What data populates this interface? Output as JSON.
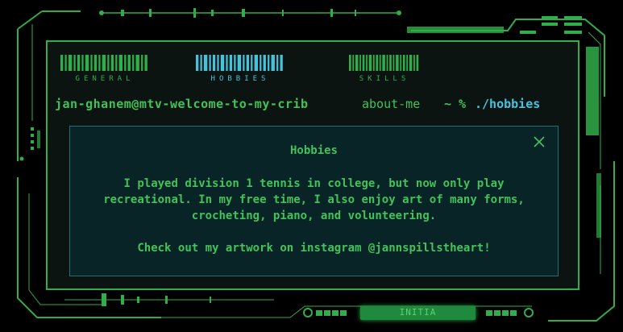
{
  "tabs": [
    {
      "label": "GENERAL",
      "color": "#2fae4a"
    },
    {
      "label": "HOBBIES",
      "color": "#48c1db",
      "active": true
    },
    {
      "label": "SKILLS",
      "color": "#2fae4a"
    }
  ],
  "prompt": {
    "user_host": "jan-ghanem@mtv-welcome-to-my-crib",
    "directory": "about-me",
    "symbol": "~ %",
    "command": "./hobbies"
  },
  "dialog": {
    "title": "Hobbies",
    "paragraph1": "I played division 1 tennis in college, but now only play recreational. In my free time, I also enjoy art of many forms, crocheting, piano, and volunteering.",
    "paragraph2": "Check out my artwork on instagram @jannspillstheart!",
    "close_icon": "close-icon"
  },
  "bottom_bar": {
    "label": "INITIA"
  },
  "colors": {
    "accent_green": "#2fae4a",
    "accent_cyan": "#48c1db",
    "dialog_bg": "#082427",
    "dialog_border": "#2a6e74"
  }
}
